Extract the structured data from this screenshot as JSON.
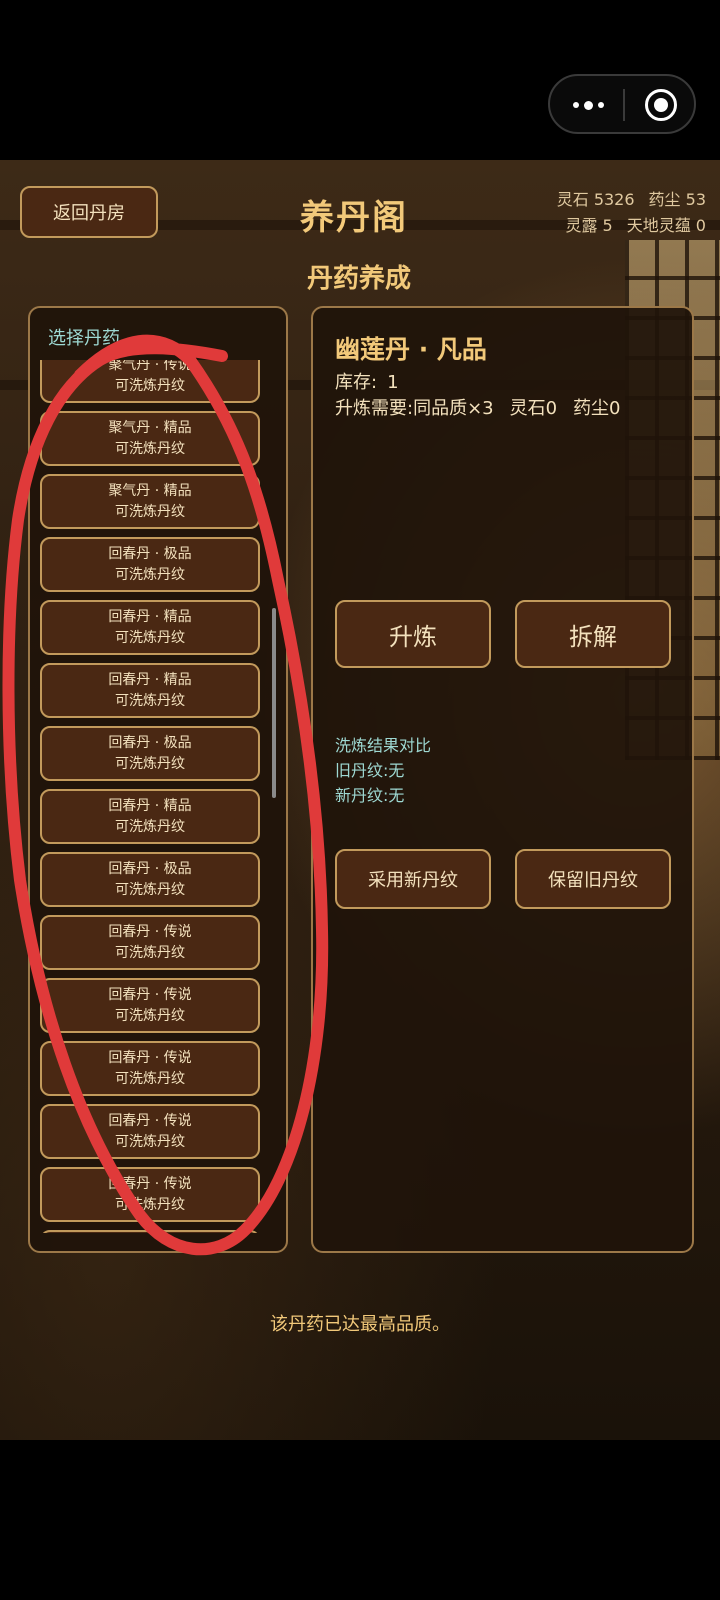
{
  "capsule": {
    "more_icon": "more-dots-icon",
    "close_icon": "target-circle-icon"
  },
  "header": {
    "back_label": "返回丹房",
    "title": "养丹阁",
    "resources_row1": [
      "灵石 5326",
      "药尘 53"
    ],
    "resources_row2": [
      "灵露 5",
      "天地灵蕴 0"
    ]
  },
  "subtitle": "丹药养成",
  "left_panel": {
    "title": "选择丹药",
    "items": [
      {
        "name": "聚气丹 · 传说",
        "status": "可洗炼丹纹"
      },
      {
        "name": "聚气丹 · 精品",
        "status": "可洗炼丹纹"
      },
      {
        "name": "聚气丹 · 精品",
        "status": "可洗炼丹纹"
      },
      {
        "name": "回春丹 · 极品",
        "status": "可洗炼丹纹"
      },
      {
        "name": "回春丹 · 精品",
        "status": "可洗炼丹纹"
      },
      {
        "name": "回春丹 · 精品",
        "status": "可洗炼丹纹"
      },
      {
        "name": "回春丹 · 极品",
        "status": "可洗炼丹纹"
      },
      {
        "name": "回春丹 · 精品",
        "status": "可洗炼丹纹"
      },
      {
        "name": "回春丹 · 极品",
        "status": "可洗炼丹纹"
      },
      {
        "name": "回春丹 · 传说",
        "status": "可洗炼丹纹"
      },
      {
        "name": "回春丹 · 传说",
        "status": "可洗炼丹纹"
      },
      {
        "name": "回春丹 · 传说",
        "status": "可洗炼丹纹"
      },
      {
        "name": "回春丹 · 传说",
        "status": "可洗炼丹纹"
      },
      {
        "name": "回春丹 · 传说",
        "status": "可洗炼丹纹"
      },
      {
        "name": "",
        "status": ""
      }
    ]
  },
  "detail": {
    "pill_name": "幽莲丹 · 凡品",
    "stock_label": "库存:",
    "stock_value": "1",
    "requirements": [
      "升炼需要:同品质×3",
      "灵石0",
      "药尘0"
    ],
    "upgrade_label": "升炼",
    "dismantle_label": "拆解",
    "compare_title": "洗炼结果对比",
    "old_pattern": "旧丹纹:无",
    "new_pattern": "新丹纹:无",
    "adopt_label": "采用新丹纹",
    "keep_label": "保留旧丹纹"
  },
  "message": "该丹药已达最高品质。",
  "colors": {
    "accent_gold": "#f2c97a",
    "teal_text": "#9ed9d3",
    "button_bg": "#4a2813",
    "scribble_red": "#e03a3a"
  }
}
